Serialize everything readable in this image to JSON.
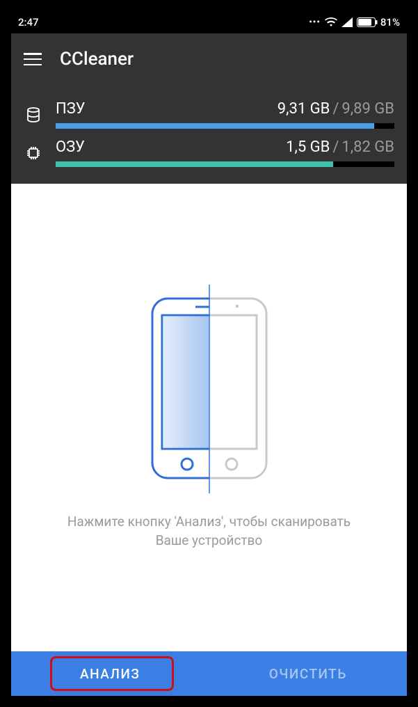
{
  "statusbar": {
    "time": "2:47",
    "battery_pct": "81%"
  },
  "toolbar": {
    "title": "CCleaner"
  },
  "usage": {
    "storage": {
      "label": "ПЗУ",
      "used": "9,31 GB",
      "total": "9,89 GB",
      "fill_pct": 94
    },
    "ram": {
      "label": "ОЗУ",
      "used": "1,5 GB",
      "total": "1,82 GB",
      "fill_pct": 82
    },
    "separator": "/"
  },
  "main": {
    "hint_line1": "Нажмите кнопку 'Анализ', чтобы сканировать",
    "hint_line2": "Ваше устройство"
  },
  "bottom": {
    "analyze": "АНАЛИЗ",
    "clean": "ОЧИСТИТЬ"
  },
  "colors": {
    "storage_bar": "#4a9fe8",
    "ram_bar": "#3fc0a8",
    "action_bar": "#3b7fe4",
    "highlight": "#d40c14"
  }
}
